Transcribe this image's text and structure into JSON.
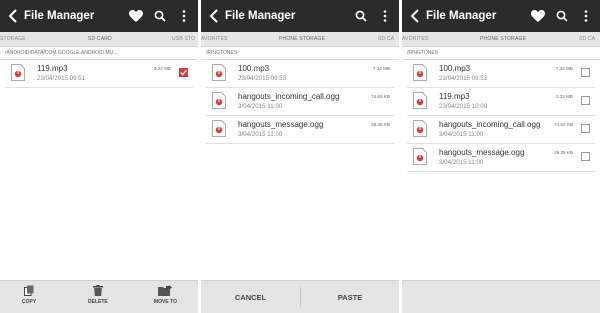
{
  "app": {
    "title": "File Manager"
  },
  "icons": {
    "back": "chevron-left-icon",
    "favorite": "heart-icon",
    "search": "search-icon",
    "more": "overflow-menu-icon",
    "file": "music-file-icon"
  },
  "colors": {
    "topbar": "#2b2b2b",
    "accent": "#d83c3c",
    "tabbar": "#e6e6e6",
    "bottombar": "#e4e4e4"
  },
  "screen1": {
    "tabs": {
      "left": "STORAGE",
      "center": "SD CARD",
      "right": "USB STO"
    },
    "path": "/ANDROID/DATA/COM.GOOGLE.ANDROID.MU...",
    "files": [
      {
        "name": "119.mp3",
        "date": "23/04/2015 09:51",
        "size": "3.22 MB",
        "checked": true
      }
    ],
    "bottom": {
      "copy": "COPY",
      "delete": "DELETE",
      "move": "MOVE TO"
    }
  },
  "screen2": {
    "tabs": {
      "left": "AVORITES",
      "center": "PHONE STORAGE",
      "right": "SD CA"
    },
    "path": "/RINGTONES",
    "files": [
      {
        "name": "100.mp3",
        "date": "23/04/2015 09:53",
        "size": "7.34 MB"
      },
      {
        "name": "hangouts_incoming_call.ogg",
        "date": "3/04/2015 11:00",
        "size": "74.63 KB"
      },
      {
        "name": "hangouts_message.ogg",
        "date": "3/04/2015 11:00",
        "size": "29.35 KB"
      }
    ],
    "bottom": {
      "cancel": "CANCEL",
      "paste": "PASTE"
    }
  },
  "screen3": {
    "tabs": {
      "left": "AVORITES",
      "center": "PHONE STORAGE",
      "right": "SD CA"
    },
    "path": "/RINGTONES",
    "files": [
      {
        "name": "100.mp3",
        "date": "23/04/2015 09:53",
        "size": "7.34 MB",
        "checked": false
      },
      {
        "name": "119.mp3",
        "date": "23/04/2015 10:09",
        "size": "3.22 MB",
        "checked": false
      },
      {
        "name": "hangouts_incoming_call.ogg",
        "date": "3/04/2015 11:00",
        "size": "74.63 KB",
        "checked": false
      },
      {
        "name": "hangouts_message.ogg",
        "date": "3/04/2015 11:00",
        "size": "29.35 KB",
        "checked": false
      }
    ]
  }
}
